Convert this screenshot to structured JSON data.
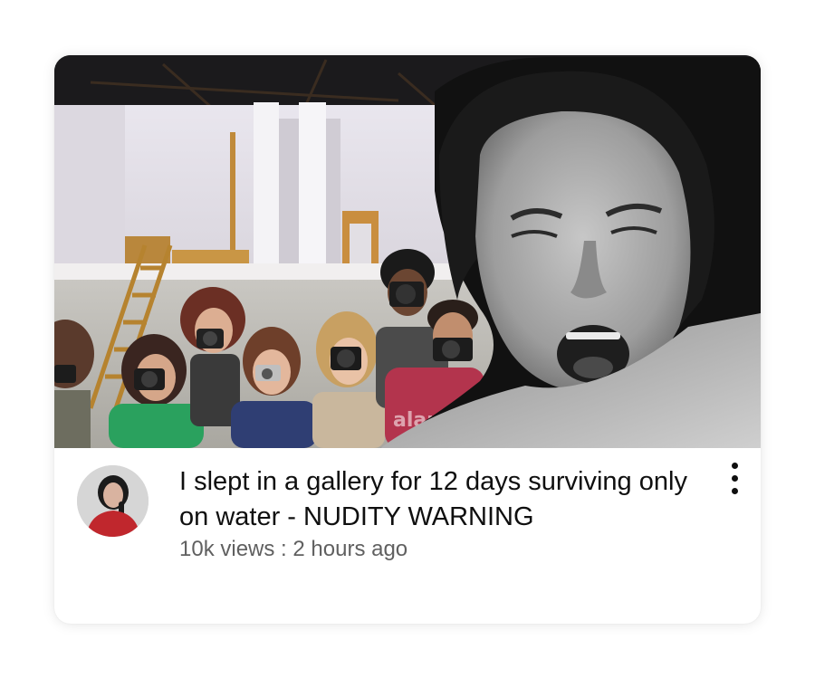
{
  "video": {
    "title": "I slept in a gallery for 12 days surviving only on water - NUDITY WARNING",
    "views": "10k views",
    "separator": " : ",
    "age": "2 hours ago",
    "thumbnail_watermark": "alamy"
  },
  "icons": {
    "more": "more-vertical-icon"
  },
  "colors": {
    "title": "#0f0f0f",
    "meta": "#606060",
    "card_background": "#ffffff"
  }
}
